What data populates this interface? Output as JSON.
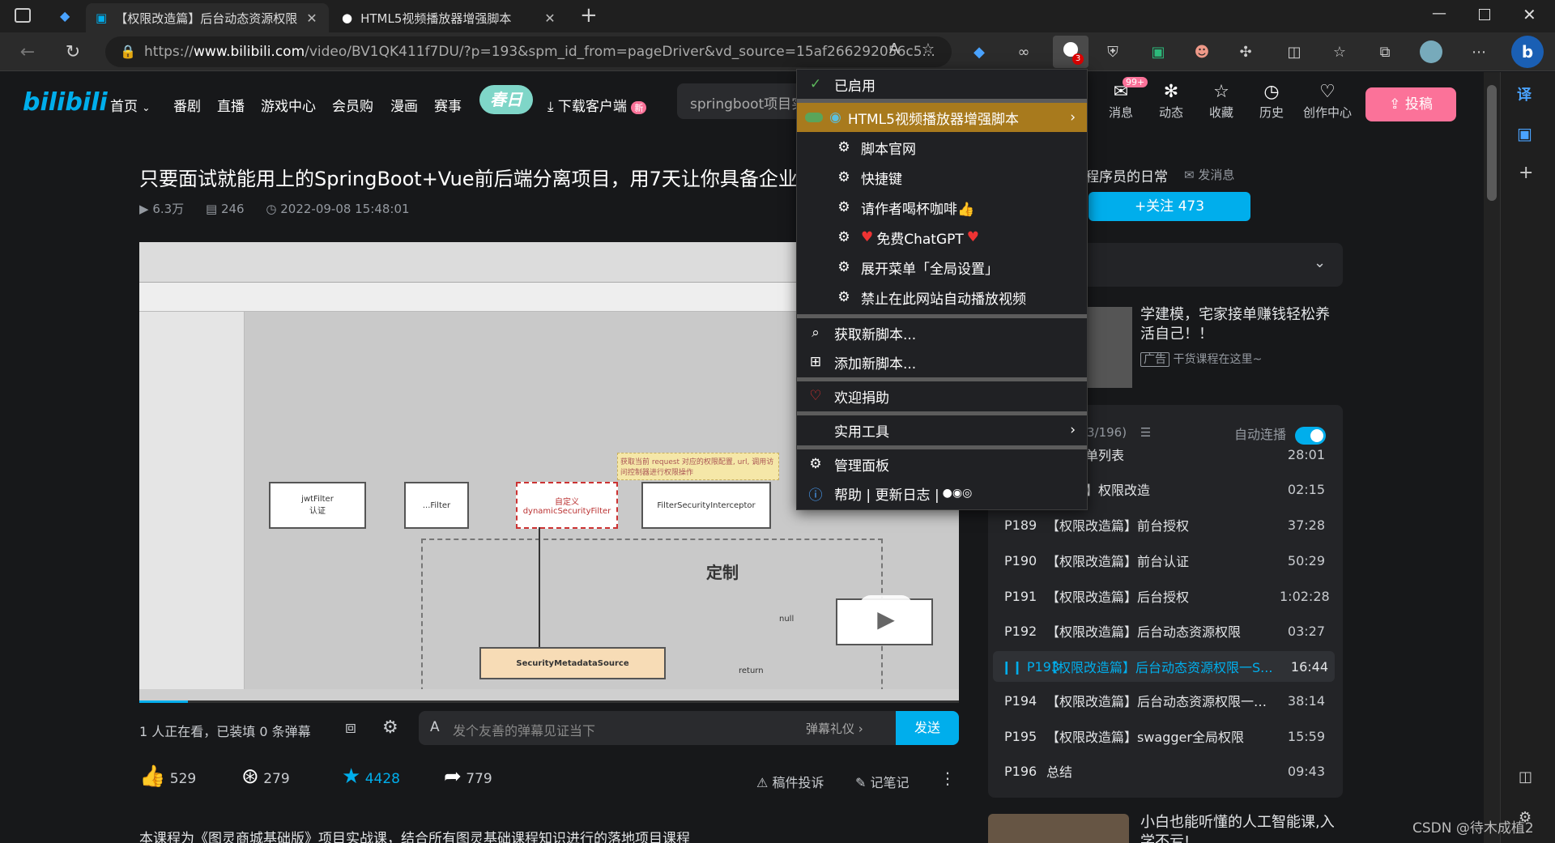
{
  "browser": {
    "tabs": [
      {
        "title": "【权限改造篇】后台动态资源权限"
      },
      {
        "title": "HTML5视频播放器增强脚本"
      }
    ],
    "address": {
      "prefix": "https://",
      "host": "www.bilibili.com",
      "path": "/video/BV1QK411f7DU/?p=193&spm_id_from=pageDriver&vd_source=15af266292056c5..."
    },
    "extension_badge": "3"
  },
  "header": {
    "logo": "bilibili",
    "nav": [
      "首页",
      "番剧",
      "直播",
      "游戏中心",
      "会员购",
      "漫画",
      "赛事"
    ],
    "festival": "春日",
    "download": "下载客户端",
    "download_badge": "新",
    "search_placeholder": "springboot项目实",
    "icons": [
      {
        "label": "消息",
        "badge": "99+"
      },
      {
        "label": "动态"
      },
      {
        "label": "收藏"
      },
      {
        "label": "历史"
      },
      {
        "label": "创作中心"
      }
    ],
    "upload": "投稿"
  },
  "video": {
    "title": "只要面试就能用上的SpringBoot+Vue前后端分离项目，用7天让你具备企业",
    "views": "6.3万",
    "danmaku": "246",
    "date": "2022-09-08 15:48:01",
    "diagram": {
      "boxes": [
        "jwtFilter\n认证",
        "...Filter",
        "自定义\ndynamicSecurityFilter",
        "FilterSecurityInterceptor",
        "SecurityMetadataSource"
      ],
      "label_custom": "定制",
      "label_null": "null",
      "label_return": "return",
      "note": "获取当前 request 对应的权限配置, url, 调用访问控制器进行权限操作"
    }
  },
  "danmaku_bar": {
    "watching": "1 人正在看，已装填 0 条弹幕",
    "placeholder": "发个友善的弹幕见证当下",
    "etiquette": "弹幕礼仪",
    "send": "发送"
  },
  "actions": {
    "like": "529",
    "coin": "279",
    "fav": "4428",
    "share": "779",
    "report": "稿件投诉",
    "note": "记笔记"
  },
  "description": "本课程为《图灵商城基础版》项目实战课，结合所有图灵基础课程知识进行的落地项目课程",
  "uploader": {
    "name": "程序员的日常",
    "message": "发消息",
    "follow": "+关注 473"
  },
  "ad": {
    "title": "学建模，宅家接单赚钱轻松养活自己！！",
    "tag": "广告",
    "sub": "干货课程在这里~"
  },
  "playlist": {
    "progress": "3/196)",
    "autoplay": "自动连播",
    "items": [
      {
        "num": "",
        "title": "我的订单列表",
        "dur": "28:01"
      },
      {
        "num": "",
        "title": "改造篇】权限改造",
        "dur": "02:15"
      },
      {
        "num": "P189",
        "title": "【权限改造篇】前台授权",
        "dur": "37:28"
      },
      {
        "num": "P190",
        "title": "【权限改造篇】前台认证",
        "dur": "50:29"
      },
      {
        "num": "P191",
        "title": "【权限改造篇】后台授权",
        "dur": "1:02:28"
      },
      {
        "num": "P192",
        "title": "【权限改造篇】后台动态资源权限",
        "dur": "03:27"
      },
      {
        "num": "P193",
        "title": "【权限改造篇】后台动态资源权限一S...",
        "dur": "16:44"
      },
      {
        "num": "P194",
        "title": "【权限改造篇】后台动态资源权限一代...",
        "dur": "38:14"
      },
      {
        "num": "P195",
        "title": "【权限改造篇】swagger全局权限",
        "dur": "15:59"
      },
      {
        "num": "P196",
        "title": "总结",
        "dur": "09:43"
      }
    ]
  },
  "rec": {
    "title": "小白也能听懂的人工智能课,入学不亏!"
  },
  "watermark": "CSDN @待木成植2",
  "menu": {
    "enabled": "已启用",
    "script": "HTML5视频播放器增强脚本",
    "sub_items": [
      "脚本官网",
      "快捷键",
      "请作者喝杯咖啡👍",
      "免费ChatGPT",
      "展开菜单「全局设置」",
      "禁止在此网站自动播放视频"
    ],
    "get_scripts": "获取新脚本...",
    "add_script": "添加新脚本...",
    "donate": "欢迎捐助",
    "tools": "实用工具",
    "dashboard": "管理面板",
    "help": "帮助 | 更新日志 |"
  },
  "colors": {
    "bili_pink": "#fb7299",
    "bili_blue": "#00aeec",
    "menu_highlight": "#a87a1d"
  }
}
